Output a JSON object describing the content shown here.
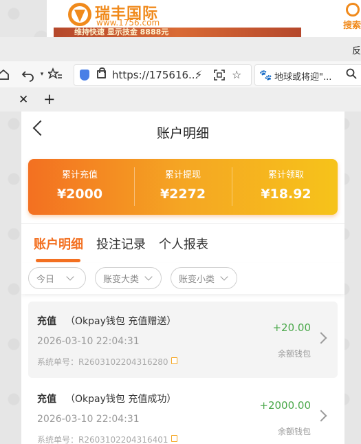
{
  "banner": {
    "brand": "瑞丰国际",
    "url": "www.1756.com",
    "strip_text": "维持快速 显示技金 8888元",
    "search_label": "搜索"
  },
  "browser": {
    "top_right_text": "反",
    "address": "https://175616...",
    "search_text": "地球或将迎\"...",
    "colors": {
      "shield": "#4a7fe6"
    }
  },
  "app": {
    "title": "账户明细",
    "summary": [
      {
        "label": "累计充值",
        "value": "¥2000"
      },
      {
        "label": "累计提现",
        "value": "¥2272"
      },
      {
        "label": "累计领取",
        "value": "¥18.92"
      }
    ],
    "tabs": [
      {
        "label": "账户明细",
        "active": true
      },
      {
        "label": "投注记录",
        "active": false
      },
      {
        "label": "个人报表",
        "active": false
      }
    ],
    "filters": [
      {
        "label": "今日"
      },
      {
        "label": "账变大类"
      },
      {
        "label": "账变小类"
      }
    ],
    "records": [
      {
        "type": "充值",
        "desc": "（Okpay钱包 充值赠送）",
        "date": "2026-03-10 22:04:31",
        "order": "系统单号：R2603102204316280",
        "amount": "+20.00",
        "wallet": "余额钱包"
      },
      {
        "type": "充值",
        "desc": "（Okpay钱包 充值成功）",
        "date": "2026-03-10 22:04:31",
        "order": "系统单号：R2603102204316401",
        "amount": "+2000.00",
        "wallet": "余额钱包"
      }
    ],
    "colors": {
      "accent": "#f37021",
      "gradient_end": "#f6c31a",
      "amount": "#4aa84a"
    }
  }
}
